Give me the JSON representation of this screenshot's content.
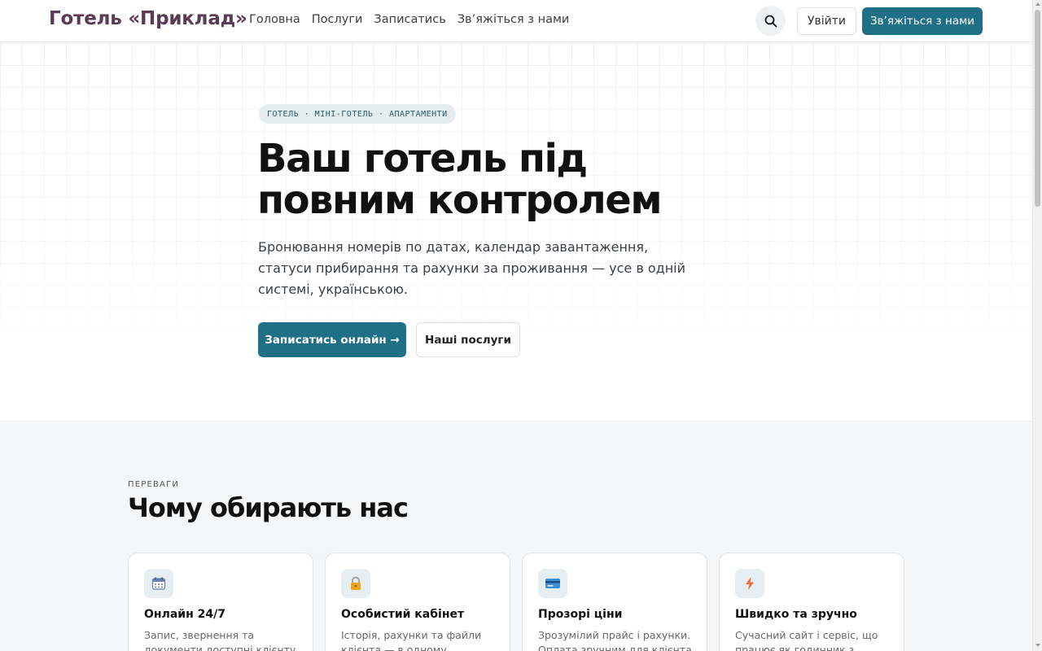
{
  "header": {
    "brand": "Готель «Приклад»",
    "nav": [
      "Головна",
      "Послуги",
      "Записатись",
      "Зв’яжіться з нами"
    ],
    "login_label": "Увійти",
    "contact_label": "Зв’яжіться з нами",
    "search_icon": "search-icon"
  },
  "hero": {
    "pill": "ГОТЕЛЬ · МІНІ-ГОТЕЛЬ · АПАРТАМЕНТИ",
    "title_line1": "Ваш готель під",
    "title_line2": "повним контролем",
    "subtitle": "Бронювання номерів по датах, календар завантаження, статуси прибирання та рахунки за проживання — усе в одній системі, українською.",
    "primary_label": "Записатись онлайн →",
    "secondary_label": "Наші послуги"
  },
  "advantages": {
    "label": "ПЕРЕВАГИ",
    "title": "Чому обирають нас",
    "cards": [
      {
        "icon": "calendar-icon",
        "title": "Онлайн 24/7",
        "text": "Запис, звернення та документи доступні клієнту"
      },
      {
        "icon": "lock-icon",
        "title": "Особистий кабінет",
        "text": "Історія, рахунки та файли клієнта — в одному"
      },
      {
        "icon": "credit-card-icon",
        "title": "Прозорі ціни",
        "text": "Зрозумілий прайс і рахунки. Оплата зручним для клієнта"
      },
      {
        "icon": "lightning-icon",
        "title": "Швидко та зручно",
        "text": "Сучасний сайт і сервіс, що працює як годинник з першого"
      }
    ]
  },
  "colors": {
    "accent": "#1f6f86",
    "brand": "#5a3a55",
    "section_bg": "#f5f6f7"
  }
}
